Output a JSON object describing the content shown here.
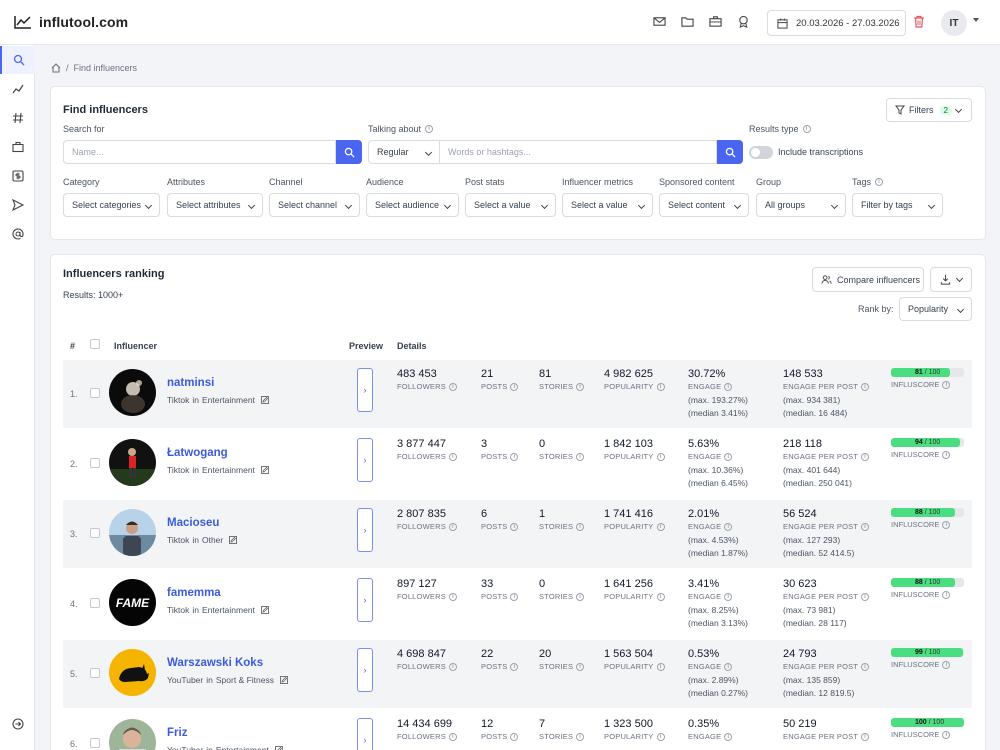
{
  "app": {
    "logo_text": "influtool.com"
  },
  "header": {
    "date_range": "20.03.2026 - 27.03.2026",
    "avatar_initials": "IT"
  },
  "breadcrumb": {
    "current": "Find influencers"
  },
  "find": {
    "title": "Find influencers",
    "filters_label": "Filters",
    "filters_count": "2",
    "search_for_label": "Search for",
    "name_placeholder": "Name...",
    "talking_about_label": "Talking about",
    "talking_mode": "Regular",
    "words_placeholder": "Words or hashtags...",
    "results_type_label": "Results type",
    "include_transcriptions": "Include transcriptions",
    "filters": [
      {
        "label": "Category",
        "value": "Select categories"
      },
      {
        "label": "Attributes",
        "value": "Select attributes"
      },
      {
        "label": "Channel",
        "value": "Select channel"
      },
      {
        "label": "Audience",
        "value": "Select audience"
      },
      {
        "label": "Post stats",
        "value": "Select a value"
      },
      {
        "label": "Influencer metrics",
        "value": "Select a value"
      },
      {
        "label": "Sponsored content",
        "value": "Select content"
      },
      {
        "label": "Group",
        "value": "All groups"
      },
      {
        "label": "Tags",
        "value": "Filter by tags"
      }
    ]
  },
  "ranking": {
    "title": "Influencers ranking",
    "results": "Results: 1000+",
    "compare_label": "Compare influencers",
    "rank_by_label": "Rank by:",
    "rank_by_value": "Popularity",
    "columns": {
      "num": "#",
      "influencer": "Influencer",
      "preview": "Preview",
      "details": "Details"
    },
    "labels": {
      "followers": "FOLLOWERS",
      "posts": "POSTS",
      "stories": "STORIES",
      "popularity": "POPULARITY",
      "engage": "ENGAGE",
      "engage_per_post": "ENGAGE PER POST",
      "influscore": "INFLUSCORE",
      "score_max": "/ 100",
      "in": "in"
    },
    "rows": [
      {
        "num": "1.",
        "name": "natminsi",
        "platform": "Tiktok",
        "category": "Entertainment",
        "followers": "483 453",
        "posts": "21",
        "stories": "81",
        "popularity": "4 982 625",
        "engage": "30.72%",
        "engage_max": "(max. 193.27%)",
        "engage_median": "(median 3.41%)",
        "epp": "148 533",
        "epp_max": "(max. 934 381)",
        "epp_median": "(median. 16 484)",
        "score": 81,
        "score_text": "81"
      },
      {
        "num": "2.",
        "name": "Łatwogang",
        "platform": "Tiktok",
        "category": "Entertainment",
        "followers": "3 877 447",
        "posts": "3",
        "stories": "0",
        "popularity": "1 842 103",
        "engage": "5.63%",
        "engage_max": "(max. 10.36%)",
        "engage_median": "(median 6.45%)",
        "epp": "218 118",
        "epp_max": "(max. 401 644)",
        "epp_median": "(median. 250 041)",
        "score": 94,
        "score_text": "94"
      },
      {
        "num": "3.",
        "name": "Macioseu",
        "platform": "Tiktok",
        "category": "Other",
        "followers": "2 807 835",
        "posts": "6",
        "stories": "1",
        "popularity": "1 741 416",
        "engage": "2.01%",
        "engage_max": "(max. 4.53%)",
        "engage_median": "(median 1.87%)",
        "epp": "56 524",
        "epp_max": "(max. 127 293)",
        "epp_median": "(median. 52 414.5)",
        "score": 88,
        "score_text": "88"
      },
      {
        "num": "4.",
        "name": "famemma",
        "platform": "Tiktok",
        "category": "Entertainment",
        "followers": "897 127",
        "posts": "33",
        "stories": "0",
        "popularity": "1 641 256",
        "engage": "3.41%",
        "engage_max": "(max. 8.25%)",
        "engage_median": "(median 3.13%)",
        "epp": "30 623",
        "epp_max": "(max. 73 981)",
        "epp_median": "(median. 28 117)",
        "score": 88,
        "score_text": "88",
        "avatar_text": "FAME"
      },
      {
        "num": "5.",
        "name": "Warszawski Koks",
        "platform": "YouTuber",
        "category": "Sport & Fitness",
        "followers": "4 698 847",
        "posts": "22",
        "stories": "20",
        "popularity": "1 563 504",
        "engage": "0.53%",
        "engage_max": "(max. 2.89%)",
        "engage_median": "(median 0.27%)",
        "epp": "24 793",
        "epp_max": "(max. 135 859)",
        "epp_median": "(median. 12 819.5)",
        "score": 99,
        "score_text": "99"
      },
      {
        "num": "6.",
        "name": "Friz",
        "platform": "YouTuber",
        "category": "Entertainment",
        "followers": "14 434 699",
        "posts": "12",
        "stories": "7",
        "popularity": "1 323 500",
        "engage": "0.35%",
        "engage_max": "",
        "engage_median": "",
        "epp": "50 219",
        "epp_max": "",
        "epp_median": "",
        "score": 100,
        "score_text": "100"
      }
    ]
  }
}
